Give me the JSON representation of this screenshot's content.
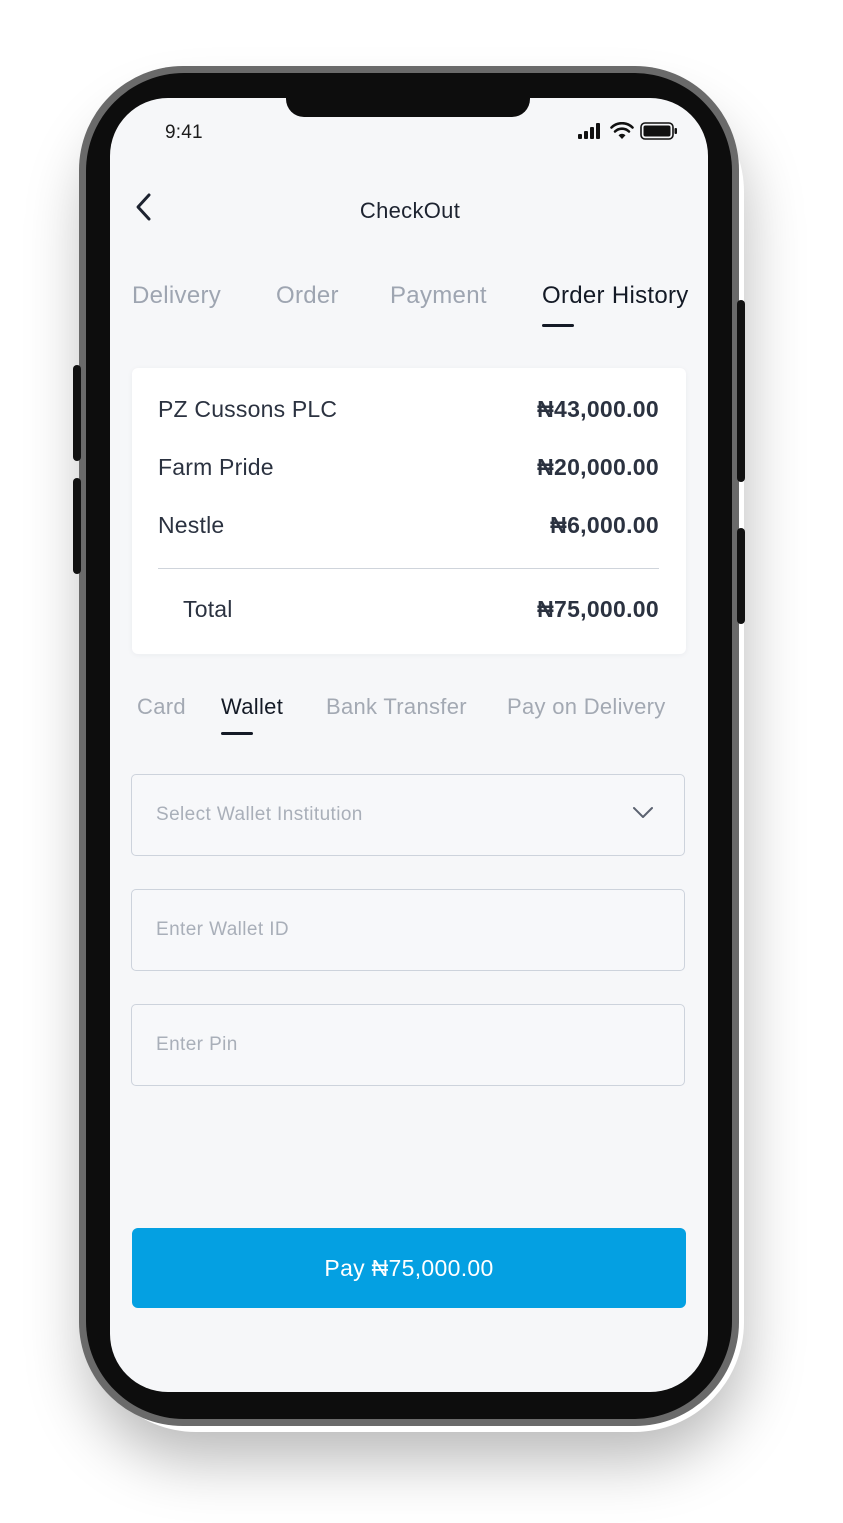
{
  "status_bar": {
    "time": "9:41"
  },
  "header": {
    "title": "CheckOut"
  },
  "checkout_tabs": [
    {
      "label": "Delivery",
      "active": false
    },
    {
      "label": "Order",
      "active": false
    },
    {
      "label": "Payment",
      "active": false
    },
    {
      "label": "Order History",
      "active": true
    }
  ],
  "order_summary": {
    "items": [
      {
        "name": "PZ Cussons PLC",
        "amount": "₦43,000.00"
      },
      {
        "name": "Farm Pride",
        "amount": "₦20,000.00"
      },
      {
        "name": "Nestle",
        "amount": "₦6,000.00"
      }
    ],
    "total_label": "Total",
    "total_amount": "₦75,000.00"
  },
  "payment_methods": [
    {
      "label": "Card",
      "active": false
    },
    {
      "label": "Wallet",
      "active": true
    },
    {
      "label": "Bank Transfer",
      "active": false
    },
    {
      "label": "Pay on Delivery",
      "active": false
    }
  ],
  "wallet_form": {
    "institution_placeholder": "Select Wallet Institution",
    "wallet_id_placeholder": "Enter Wallet ID",
    "pin_placeholder": "Enter Pin"
  },
  "pay_button": {
    "label": "Pay ₦75,000.00"
  },
  "colors": {
    "accent": "#04a0e2",
    "active_text": "#141a26",
    "inactive_text": "#9ea5b1",
    "screen_background": "#f6f7f9"
  }
}
